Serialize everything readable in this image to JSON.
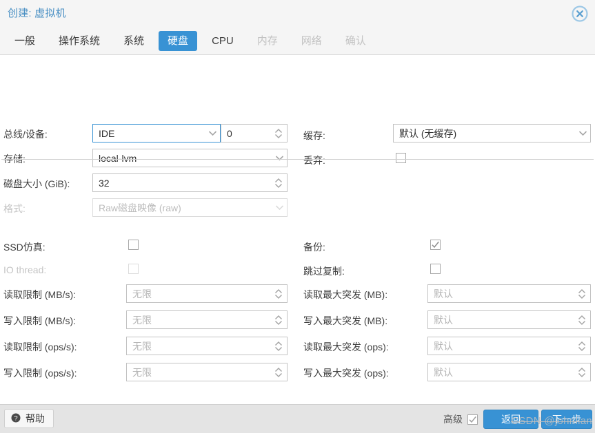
{
  "window": {
    "title": "创建: 虚拟机",
    "close_icon": "close-circle-icon"
  },
  "tabs": [
    {
      "label": "一般",
      "state": "normal"
    },
    {
      "label": "操作系统",
      "state": "normal"
    },
    {
      "label": "系统",
      "state": "normal"
    },
    {
      "label": "硬盘",
      "state": "active"
    },
    {
      "label": "CPU",
      "state": "normal"
    },
    {
      "label": "内存",
      "state": "disabled"
    },
    {
      "label": "网络",
      "state": "disabled"
    },
    {
      "label": "确认",
      "state": "disabled"
    }
  ],
  "form": {
    "left": {
      "bus_device": {
        "label": "总线/设备:",
        "bus_value": "IDE",
        "device_value": "0"
      },
      "storage": {
        "label": "存储:",
        "value": "local-lvm"
      },
      "disk_size": {
        "label": "磁盘大小 (GiB):",
        "value": "32"
      },
      "format": {
        "label": "格式:",
        "value": "Raw磁盘映像 (raw)",
        "disabled": true
      },
      "ssd_emulation": {
        "label": "SSD仿真:",
        "checked": false
      },
      "io_thread": {
        "label": "IO thread:",
        "checked": false,
        "disabled": true
      },
      "read_limit_mb": {
        "label": "读取限制 (MB/s):",
        "placeholder": "无限"
      },
      "write_limit_mb": {
        "label": "写入限制 (MB/s):",
        "placeholder": "无限"
      },
      "read_limit_ops": {
        "label": "读取限制 (ops/s):",
        "placeholder": "无限"
      },
      "write_limit_ops": {
        "label": "写入限制 (ops/s):",
        "placeholder": "无限"
      }
    },
    "right": {
      "cache": {
        "label": "缓存:",
        "value": "默认 (无缓存)"
      },
      "discard": {
        "label": "丢弃:",
        "checked": false
      },
      "backup": {
        "label": "备份:",
        "checked": true
      },
      "skip_replication": {
        "label": "跳过复制:",
        "checked": false
      },
      "read_burst_mb": {
        "label": "读取最大突发 (MB):",
        "placeholder": "默认"
      },
      "write_burst_mb": {
        "label": "写入最大突发 (MB):",
        "placeholder": "默认"
      },
      "read_burst_ops": {
        "label": "读取最大突发 (ops):",
        "placeholder": "默认"
      },
      "write_burst_ops": {
        "label": "写入最大突发 (ops):",
        "placeholder": "默认"
      }
    }
  },
  "footer": {
    "help_label": "帮助",
    "help_icon": "question-circle-icon",
    "advanced_label": "高级",
    "advanced_checked": true,
    "back_label": "返回",
    "next_label": "下一步",
    "watermark": "CSDN @johnlian"
  },
  "colors": {
    "accent": "#3892d4",
    "title": "#4a90c4",
    "header_bg": "#f5f5f5",
    "footer_bg": "#e4e4e4",
    "border": "#c2c2c2",
    "disabled_text": "#c5c5c5"
  }
}
